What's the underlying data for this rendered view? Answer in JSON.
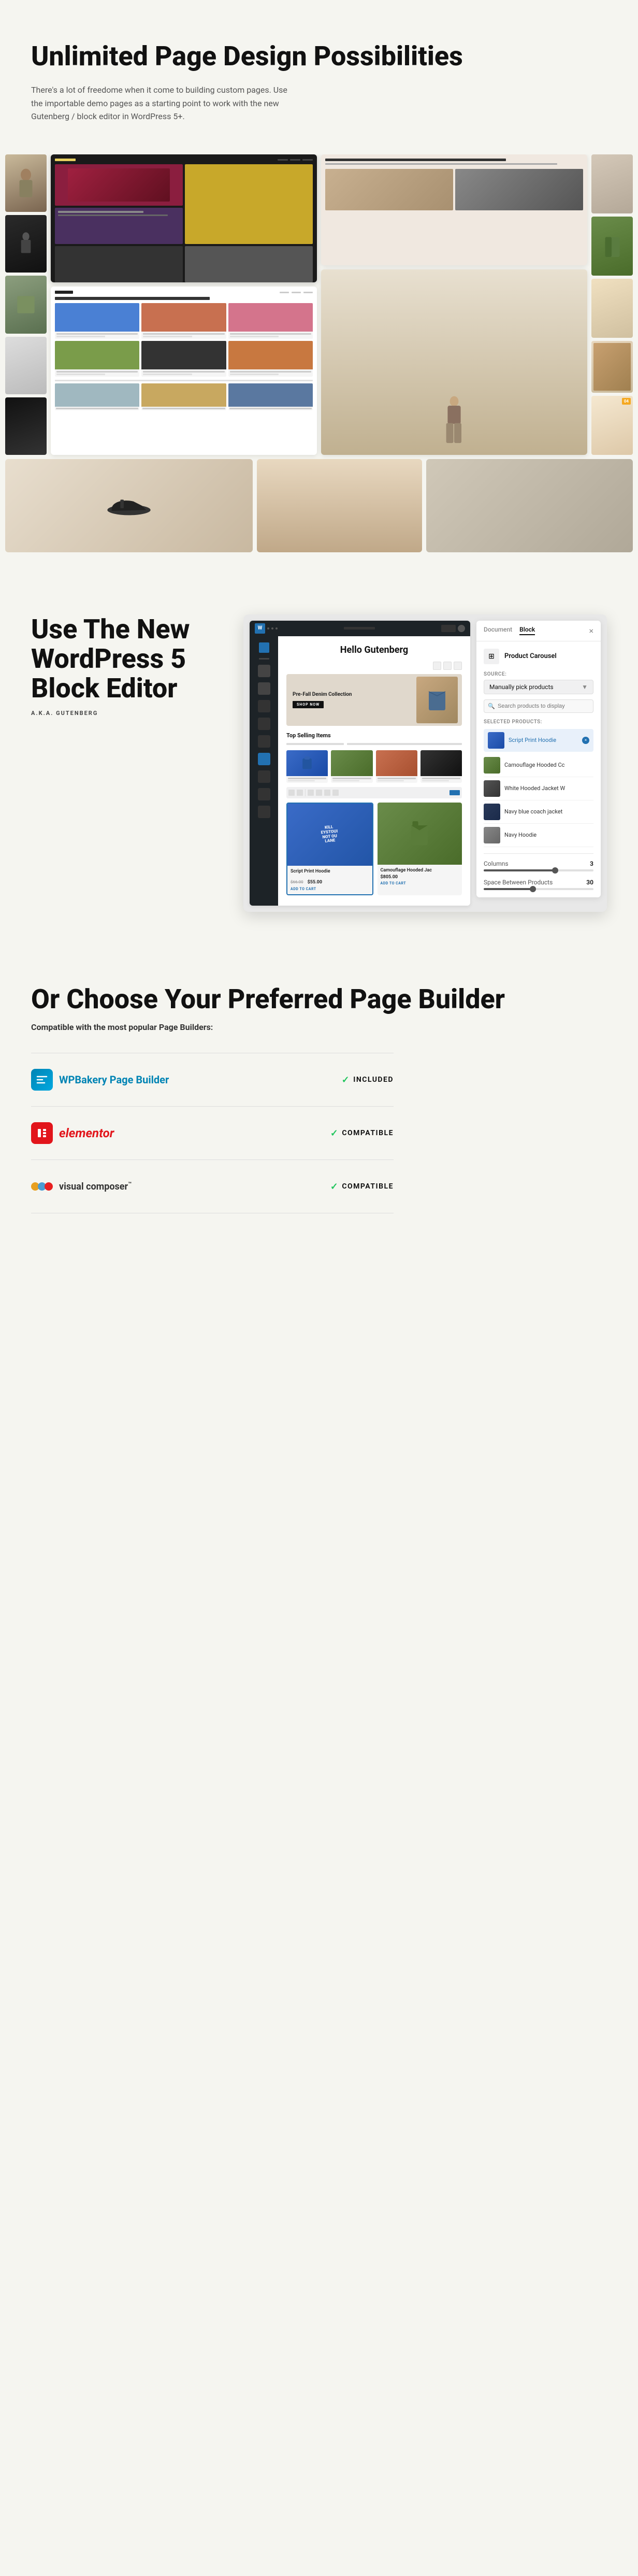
{
  "section1": {
    "title": "Unlimited Page Design Possibilities",
    "description": "There's a lot of freedome when it come to building custom pages. Use the importable demo pages as a starting point to work with the new Gutenberg / block editor in WordPress 5+."
  },
  "section2": {
    "title": "Use The New WordPress 5 Block Editor",
    "subtitle": "A.K.A. GUTENBERG",
    "editor": {
      "title": "Hello Gutenberg",
      "hero_title": "Pre-Fall Denim Collection",
      "hero_btn": "SHOP NOW",
      "top_selling": "Top Selling Items",
      "products": [
        {
          "name": "Script Print Hoodie",
          "old_price": "$66.00",
          "new_price": "$55.00",
          "add_cart": "ADD TO CART",
          "color": "blue"
        },
        {
          "name": "Camouflage Hooded Jac",
          "price": "$805.00",
          "add_cart": "ADD TO CART",
          "color": "camo"
        }
      ]
    },
    "block_panel": {
      "doc_tab": "Document",
      "block_tab": "Block",
      "close": "×",
      "block_name": "Product Carousel",
      "source_label": "Source:",
      "source_value": "Manually pick products",
      "search_placeholder": "Search products to display",
      "selected_label": "Selected Products:",
      "products": [
        {
          "name": "Script Print Hoodie",
          "color": "blue",
          "active": true
        },
        {
          "name": "Camouflage Hooded Cc",
          "color": "camo",
          "active": false
        },
        {
          "name": "White Hooded Jacket W",
          "color": "dark",
          "active": false
        },
        {
          "name": "Navy blue coach jacket",
          "color": "dark",
          "active": false
        },
        {
          "name": "Navy Hoodie",
          "color": "gray",
          "active": false
        }
      ],
      "columns_label": "Columns",
      "columns_value": "3",
      "space_label": "Space Between Products",
      "space_value": "30"
    }
  },
  "section3": {
    "title": "Or Choose Your Preferred Page Builder",
    "compat_label": "Compatible with the most popular Page Builders:",
    "builders": [
      {
        "name": "WPBakery Page Builder",
        "badge": "INCLUDED",
        "badge_type": "included"
      },
      {
        "name": "elementor",
        "badge": "COMPATIBLE",
        "badge_type": "compatible"
      },
      {
        "name": "visual composer™",
        "badge": "COMPATIBLE",
        "badge_type": "compatible"
      }
    ]
  },
  "gallery": {
    "strip_left": [
      "fashion-1",
      "fashion-2",
      "fashion-3"
    ],
    "strip_right": [
      "fashion-4",
      "fashion-5",
      "fashion-6"
    ]
  },
  "colors": {
    "accent_blue": "#2271b1",
    "green_check": "#22c55e",
    "bg": "#f5f5f0",
    "dark": "#111"
  }
}
